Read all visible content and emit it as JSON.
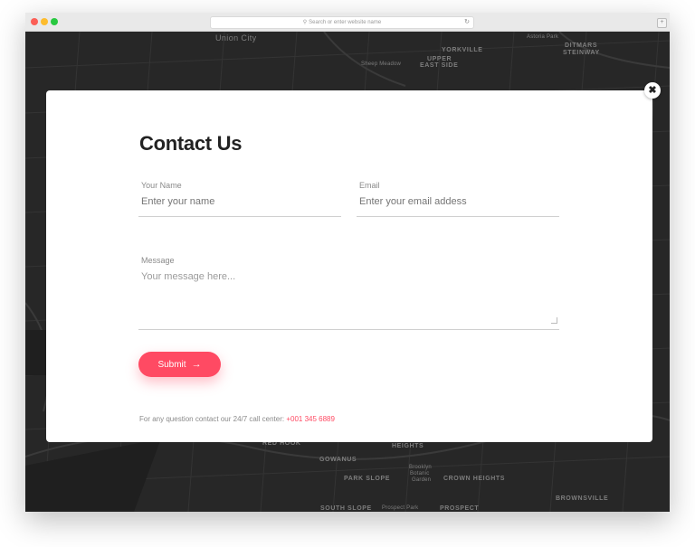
{
  "browser": {
    "address_placeholder": "Search or enter website name",
    "search_icon": "magnifier-icon",
    "reload_icon": "reload-icon",
    "newtab_icon": "plus-icon"
  },
  "map_labels": {
    "union_city": "Union City",
    "yorkville": "YORKVILLE",
    "upper": "UPPER",
    "east_side": "EAST SIDE",
    "sheep_meadow": "Sheep Meadow",
    "astoria_park": "Astoria Park",
    "ditmars": "DITMARS",
    "steinway": "STEINWAY",
    "red_hook": "RED HOOK",
    "heights": "HEIGHTS",
    "gowanus": "GOWANUS",
    "brooklyn_botanic_1": "Brooklyn",
    "brooklyn_botanic_2": "Botanic",
    "brooklyn_botanic_3": "Garden",
    "park_slope": "PARK SLOPE",
    "crown_heights": "CROWN HEIGHTS",
    "brownsville": "BROWNSVILLE",
    "south_slope": "SOUTH SLOPE",
    "prospect_park": "Prospect Park",
    "prospect": "PROSPECT"
  },
  "modal": {
    "close_icon": "close-icon",
    "title": "Contact Us",
    "name_label": "Your Name",
    "name_placeholder": "Enter your name",
    "email_label": "Email",
    "email_placeholder": "Enter your email addess",
    "message_label": "Message",
    "message_placeholder": "Your message here...",
    "submit_label": "Submit",
    "submit_icon": "arrow-right-icon",
    "footer_text": "For any question contact our 24/7 call center:",
    "footer_phone": "+001 345 6889"
  },
  "colors": {
    "accent": "#ff4a63",
    "map_bg": "#272727",
    "title": "#222222"
  }
}
